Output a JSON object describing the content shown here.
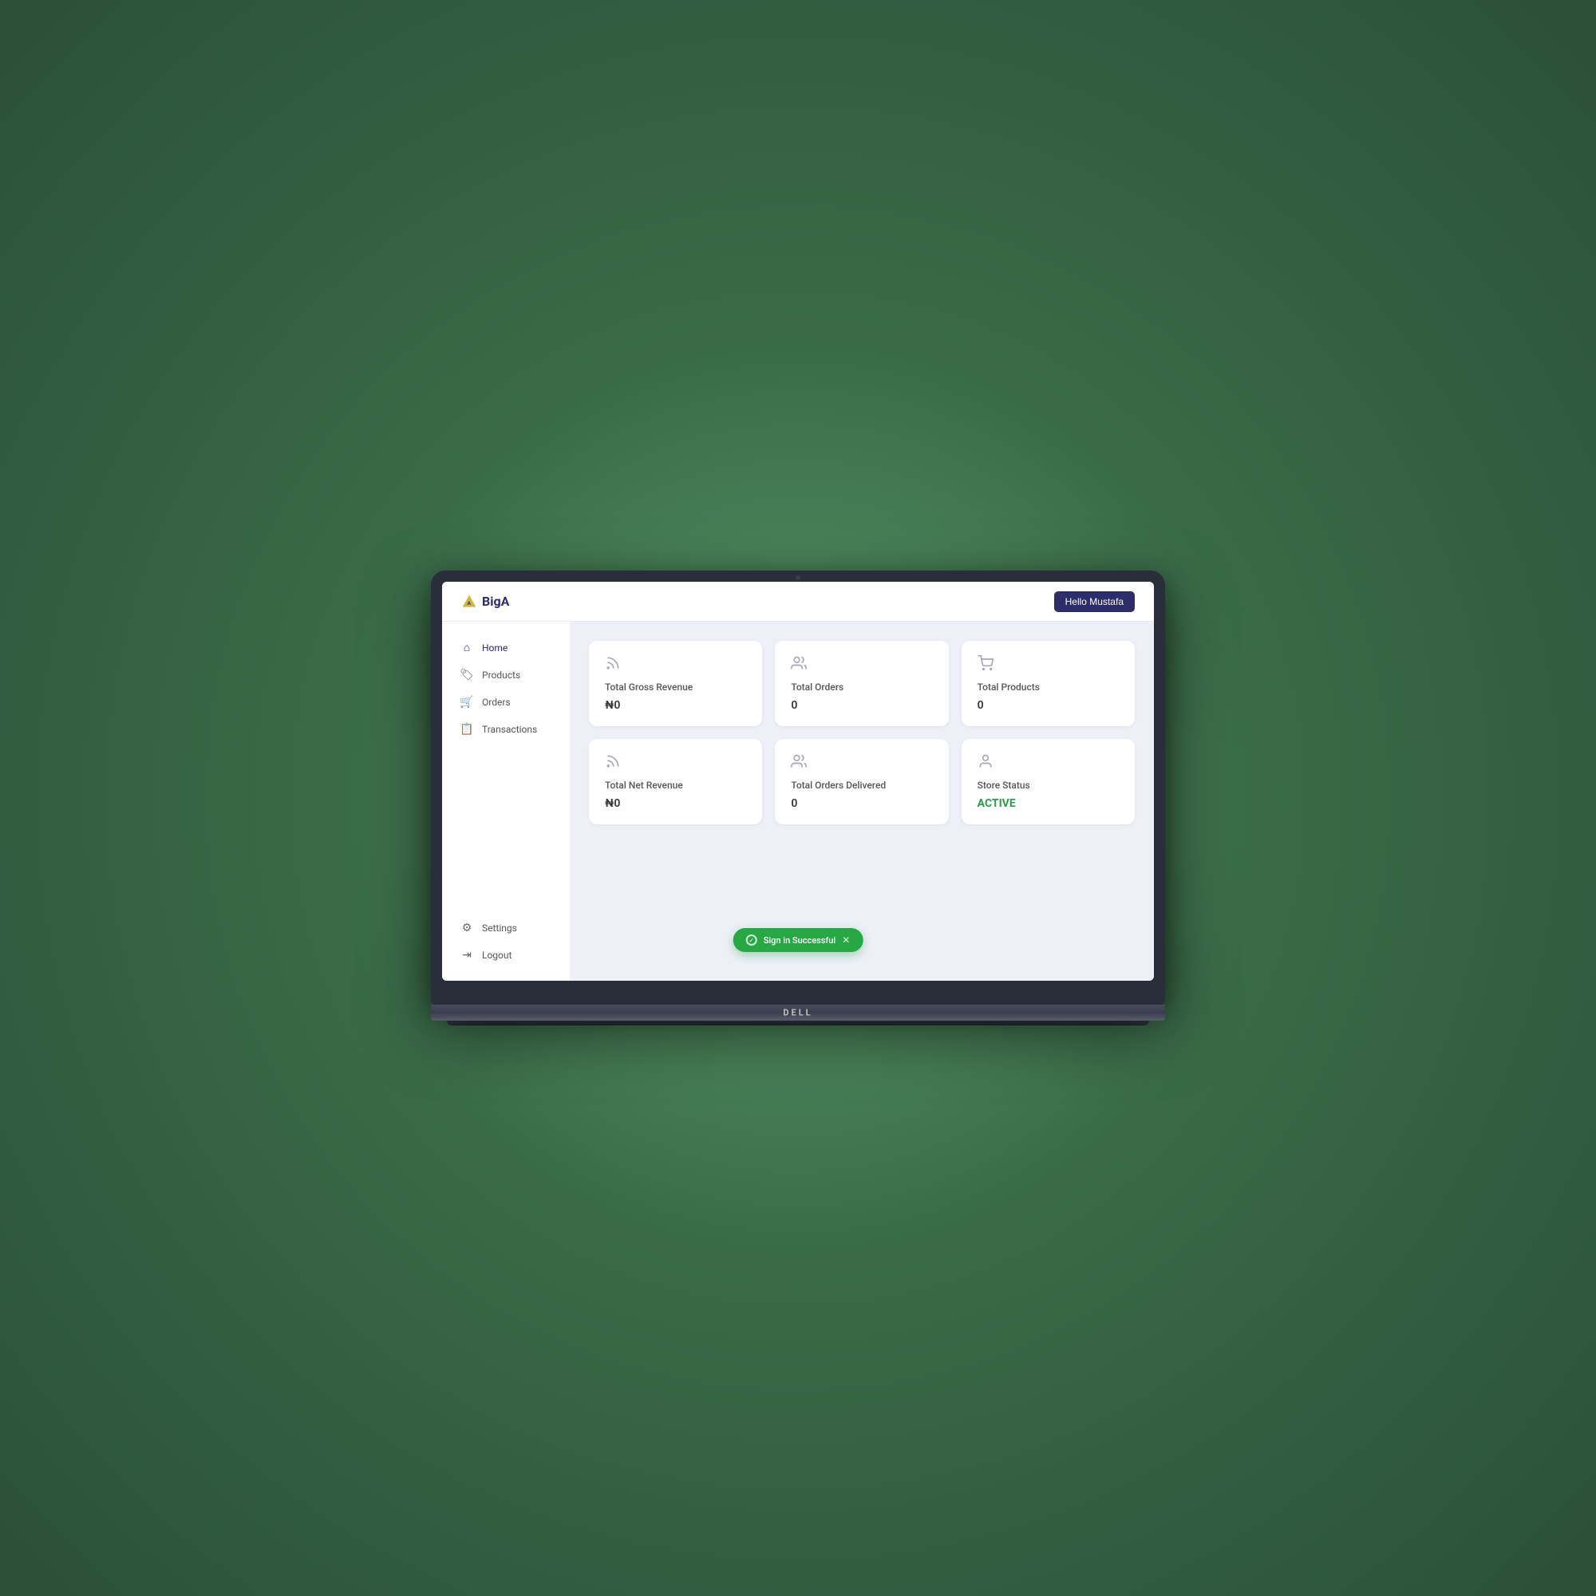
{
  "app": {
    "logo_text": "BigA",
    "hello_btn": "Hello Mustafa"
  },
  "sidebar": {
    "nav_items": [
      {
        "id": "home",
        "label": "Home",
        "icon": "⌂",
        "active": true
      },
      {
        "id": "products",
        "label": "Products",
        "icon": "🏷",
        "active": false
      },
      {
        "id": "orders",
        "label": "Orders",
        "icon": "🛒",
        "active": false
      },
      {
        "id": "transactions",
        "label": "Transactions",
        "icon": "📋",
        "active": false
      }
    ],
    "bottom_items": [
      {
        "id": "settings",
        "label": "Settings",
        "icon": "⚙"
      },
      {
        "id": "logout",
        "label": "Logout",
        "icon": "→"
      }
    ]
  },
  "stats": {
    "row1": [
      {
        "id": "gross-revenue",
        "icon": "rss",
        "title": "Total Gross Revenue",
        "value": "₦0"
      },
      {
        "id": "total-orders",
        "icon": "people",
        "title": "Total Orders",
        "value": "0"
      },
      {
        "id": "total-products",
        "icon": "cart",
        "title": "Total Products",
        "value": "0"
      }
    ],
    "row2": [
      {
        "id": "net-revenue",
        "icon": "rss",
        "title": "Total Net Revenue",
        "value": "₦0"
      },
      {
        "id": "orders-delivered",
        "icon": "people",
        "title": "Total Orders Delivered",
        "value": "0"
      },
      {
        "id": "store-status",
        "icon": "person",
        "title": "Store Status",
        "value": "ACTIVE",
        "status": "active"
      }
    ]
  },
  "toast": {
    "message": "Sign in Successful",
    "type": "success"
  }
}
